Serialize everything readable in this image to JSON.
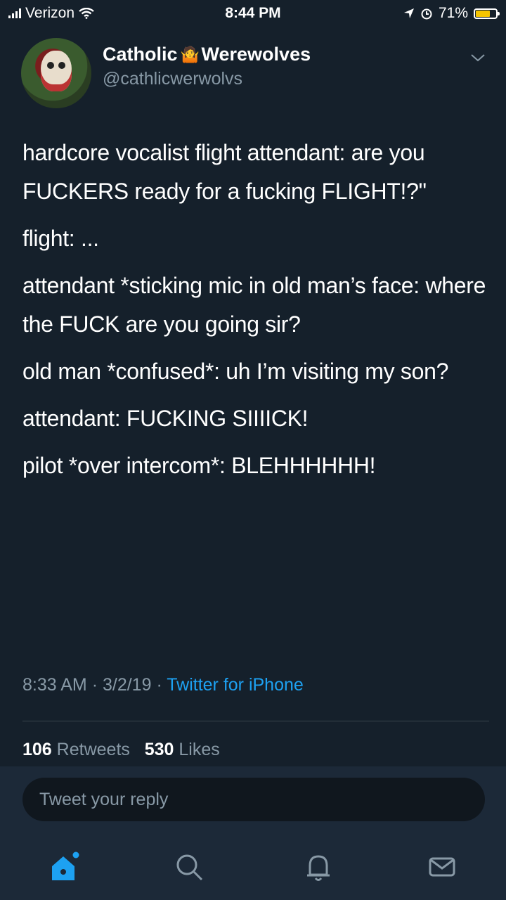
{
  "status": {
    "carrier": "Verizon",
    "time": "8:44 PM",
    "battery": "71%",
    "battery_level": 0.71
  },
  "tweet": {
    "display_name_first": "Catholic",
    "display_name_second": "Werewolves",
    "name_emoji": "🤷",
    "handle": "@cathlicwerwolvs",
    "paragraphs": [
      "hardcore vocalist flight attendant: are you FUCKERS ready for a fucking FLIGHT!?\"",
      "flight: ...",
      "attendant *sticking mic in old man’s face: where the FUCK are you going sir?",
      "old man *confused*: uh I’m visiting my son?",
      "attendant: FUCKING SIIIICK!",
      "pilot *over intercom*: BLEHHHHHH!"
    ],
    "time": "8:33 AM",
    "date": "3/2/19",
    "separator": "·",
    "source": "Twitter for iPhone"
  },
  "stats": {
    "retweets_count": "106",
    "retweets_label": "Retweets",
    "likes_count": "530",
    "likes_label": "Likes"
  },
  "reply": {
    "placeholder": "Tweet your reply"
  },
  "tabbar": {
    "icons": [
      "home-icon",
      "search-icon",
      "notifications-icon",
      "messages-icon"
    ],
    "accent": "#1da1f2",
    "inactive": "#8899a6"
  }
}
